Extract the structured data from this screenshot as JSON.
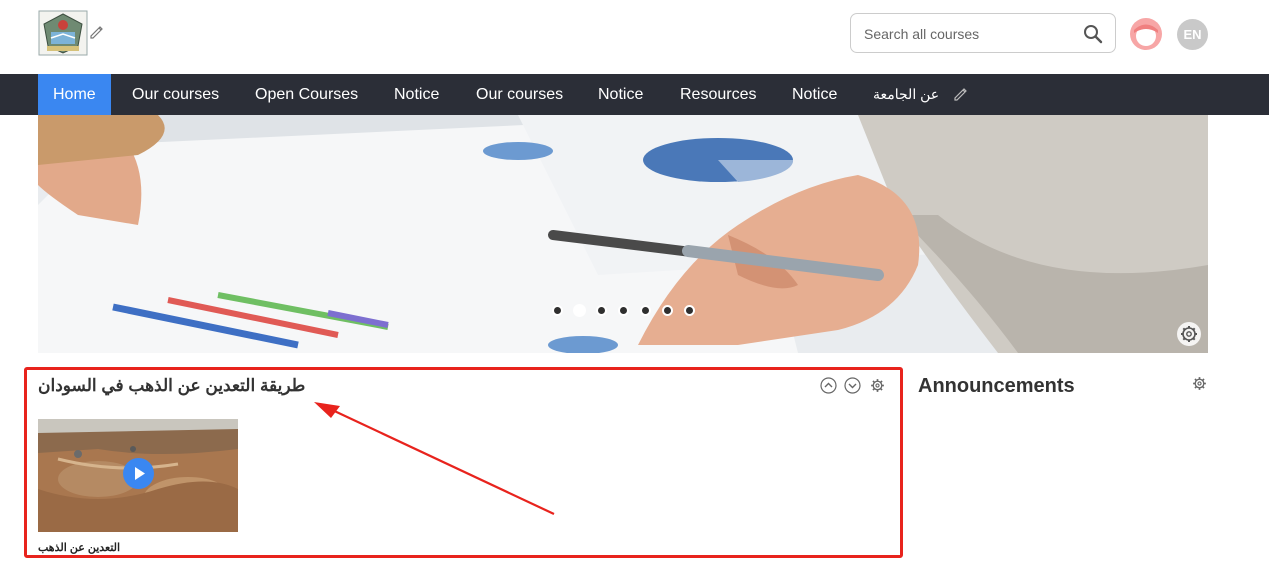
{
  "header": {
    "search_placeholder": "Search all courses",
    "language": "EN"
  },
  "nav": {
    "items": [
      {
        "label": "Home",
        "active": true
      },
      {
        "label": "Our courses"
      },
      {
        "label": "Open Courses"
      },
      {
        "label": "Notice"
      },
      {
        "label": "Our courses"
      },
      {
        "label": "Notice"
      },
      {
        "label": "Resources"
      },
      {
        "label": "Notice"
      },
      {
        "label": "عن الجامعة"
      }
    ]
  },
  "slider": {
    "dot_count": 7,
    "active_dot": 2
  },
  "block": {
    "title": "طريقة التعدين عن الذهب في السودان",
    "video_caption": "التعدين عن الذهب"
  },
  "announcements": {
    "title": "Announcements"
  },
  "colors": {
    "nav_bg": "#2b2e37",
    "accent": "#3a87f1",
    "highlight": "#e8231d"
  }
}
